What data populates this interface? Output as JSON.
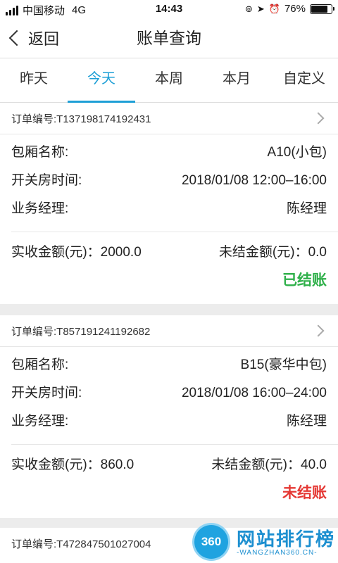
{
  "status": {
    "carrier": "中国移动",
    "network": "4G",
    "time": "14:43",
    "battery": "76%",
    "battery_level": 0.76
  },
  "nav": {
    "back_label": "返回",
    "title": "账单查询"
  },
  "tabs": [
    {
      "label": "昨天",
      "active": false
    },
    {
      "label": "今天",
      "active": true
    },
    {
      "label": "本周",
      "active": false
    },
    {
      "label": "本月",
      "active": false
    },
    {
      "label": "自定义",
      "active": false
    }
  ],
  "orders": [
    {
      "order_no": "订单编号:T137198174192431",
      "room_label": "包厢名称:",
      "room_value": "A10(小包)",
      "time_label": "开关房时间:",
      "time_value": "2018/01/08 12:00–16:00",
      "manager_label": "业务经理:",
      "manager_value": "陈经理",
      "received": "实收金额(元)：2000.0",
      "unsettled": "未结金额(元)：0.0",
      "status": "已结账"
    },
    {
      "order_no": "订单编号:T857191241192682",
      "room_label": "包厢名称:",
      "room_value": "B15(豪华中包)",
      "time_label": "开关房时间:",
      "time_value": "2018/01/08 16:00–24:00",
      "manager_label": "业务经理:",
      "manager_value": "陈经理",
      "received": "实收金额(元)：860.0",
      "unsettled": "未结金额(元)：40.0",
      "status": "未结账"
    },
    {
      "order_no": "订单编号:T472847501027004"
    }
  ],
  "watermark": {
    "badge": "360",
    "name": "网站排行榜",
    "url": "-WANGZHAN360.CN-"
  },
  "colors": {
    "accent": "#1e9fd6",
    "paid": "#2fb04a",
    "unpaid": "#e53935"
  }
}
